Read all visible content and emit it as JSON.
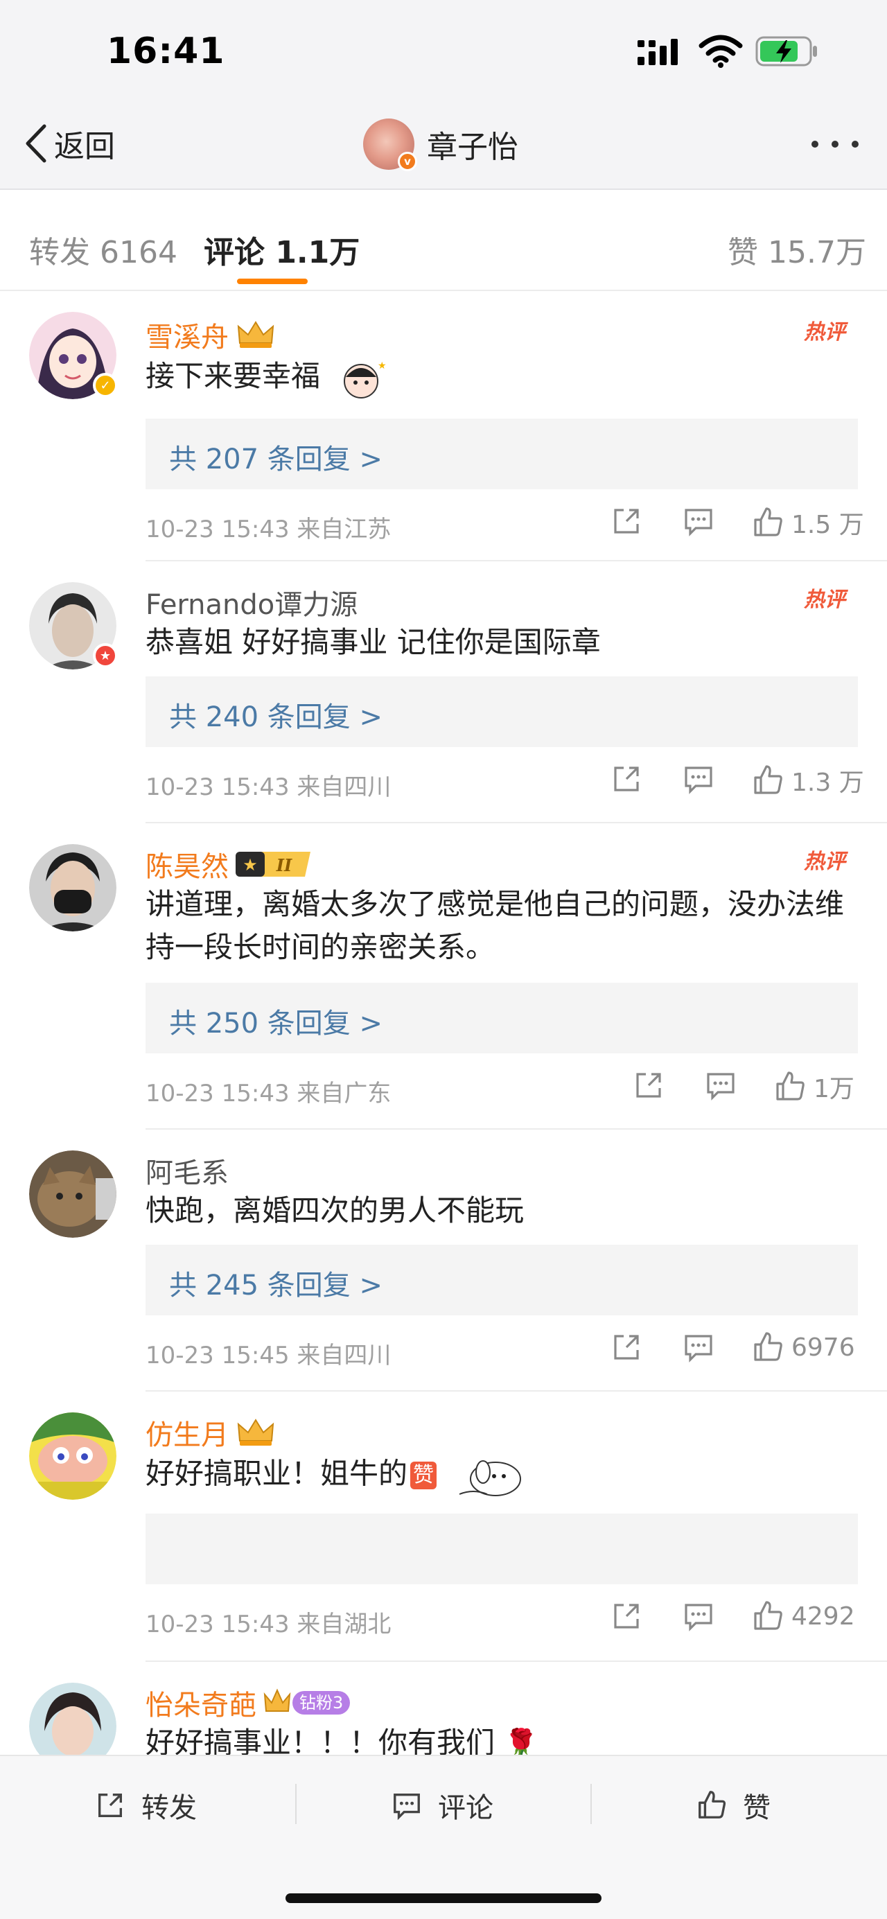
{
  "status": {
    "time": "16:41"
  },
  "nav": {
    "back_label": "返回",
    "title": "章子怡"
  },
  "tabs": {
    "repost": "转发 6164",
    "comment": "评论 1.1万",
    "like": "赞 15.7万"
  },
  "hot_label": "热评",
  "comments": [
    {
      "name": "雪溪舟",
      "text": "接下来要幸福",
      "replies": "共 207 条回复 >",
      "meta": "10-23 15:43  来自江苏",
      "likes": "1.5 万"
    },
    {
      "name": "Fernando谭力源",
      "text": "恭喜姐 好好搞事业 记住你是国际章",
      "replies": "共 240 条回复 >",
      "meta": "10-23 15:43  来自四川",
      "likes": "1.3 万"
    },
    {
      "name": "陈昊然",
      "text": "讲道理，离婚太多次了感觉是他自己的问题，没办法维持一段长时间的亲密关系。",
      "replies": "共 250 条回复 >",
      "meta": "10-23 15:43  来自广东",
      "likes": "1万"
    },
    {
      "name": "阿毛系",
      "text": "快跑，离婚四次的男人不能玩",
      "replies": "共 245 条回复 >",
      "meta": "10-23 15:45  来自四川",
      "likes": "6976"
    },
    {
      "name": "仿生月",
      "text": "好好搞职业！姐牛的",
      "zan": "赞",
      "meta": "10-23 15:43  来自湖北",
      "likes": "4292"
    },
    {
      "name": "怡朵奇葩",
      "fan_badge": "钻粉3",
      "text": "好好搞事业！！！你有我们"
    }
  ],
  "rank_badge": "II",
  "bottom": {
    "repost": "转发",
    "comment": "评论",
    "like": "赞"
  },
  "colors": {
    "accent": "#ff8200",
    "username_vip": "#f27b1d",
    "reply_link": "#4b7aa6",
    "hot": "#f05a3a"
  },
  "icons": [
    "signal-icon",
    "wifi-icon",
    "battery-charging-icon",
    "back-chevron-icon",
    "more-icon",
    "share-icon",
    "comment-icon",
    "like-icon",
    "crown-icon"
  ]
}
